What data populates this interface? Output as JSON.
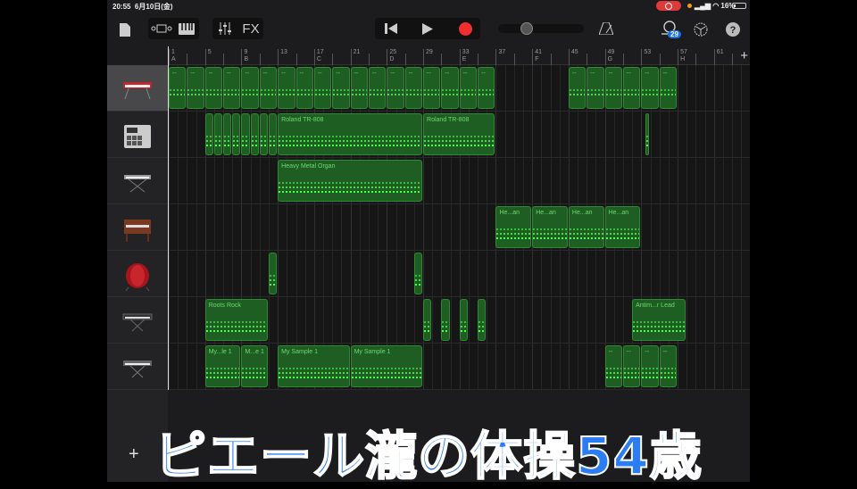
{
  "status_bar": {
    "time": "20:55",
    "date": "6月10日(金)",
    "battery": "16%"
  },
  "toolbar": {
    "fx_label": "FX",
    "loop_badge": "29",
    "icons": [
      "document-icon",
      "tracks-view-icon",
      "keyboard-icon",
      "mixer-icon",
      "rewind-icon",
      "play-icon",
      "record-icon",
      "metronome-icon",
      "loop-icon",
      "settings-icon",
      "help-icon"
    ]
  },
  "ruler": {
    "bars": [
      {
        "n": "1",
        "s": "A"
      },
      {
        "n": "5",
        "s": ""
      },
      {
        "n": "9",
        "s": "B"
      },
      {
        "n": "13",
        "s": ""
      },
      {
        "n": "17",
        "s": "C"
      },
      {
        "n": "21",
        "s": ""
      },
      {
        "n": "25",
        "s": "D"
      },
      {
        "n": "29",
        "s": ""
      },
      {
        "n": "33",
        "s": "E"
      },
      {
        "n": "37",
        "s": ""
      },
      {
        "n": "41",
        "s": "F"
      },
      {
        "n": "45",
        "s": ""
      },
      {
        "n": "49",
        "s": "G"
      },
      {
        "n": "53",
        "s": ""
      },
      {
        "n": "57",
        "s": "H"
      },
      {
        "n": "61",
        "s": ""
      }
    ],
    "add": "+"
  },
  "tracks": [
    {
      "instrument": "keyboard-red",
      "selected": true,
      "regions": [
        {
          "s": 1,
          "l": 2,
          "t": "--"
        },
        {
          "s": 3,
          "l": 2,
          "t": "--"
        },
        {
          "s": 5,
          "l": 2,
          "t": "--"
        },
        {
          "s": 7,
          "l": 2,
          "t": "--"
        },
        {
          "s": 9,
          "l": 2,
          "t": "--"
        },
        {
          "s": 11,
          "l": 2,
          "t": "--"
        },
        {
          "s": 13,
          "l": 2,
          "t": "--"
        },
        {
          "s": 15,
          "l": 2,
          "t": "--"
        },
        {
          "s": 17,
          "l": 2,
          "t": "--"
        },
        {
          "s": 19,
          "l": 2,
          "t": "--"
        },
        {
          "s": 21,
          "l": 2,
          "t": "--"
        },
        {
          "s": 23,
          "l": 2,
          "t": "--"
        },
        {
          "s": 25,
          "l": 2,
          "t": "--"
        },
        {
          "s": 27,
          "l": 2,
          "t": "--"
        },
        {
          "s": 29,
          "l": 2,
          "t": "--"
        },
        {
          "s": 31,
          "l": 2,
          "t": "--"
        },
        {
          "s": 33,
          "l": 2,
          "t": "--"
        },
        {
          "s": 35,
          "l": 2,
          "t": "--"
        },
        {
          "s": 45,
          "l": 2,
          "t": "--"
        },
        {
          "s": 47,
          "l": 2,
          "t": "--"
        },
        {
          "s": 49,
          "l": 2,
          "t": "--"
        },
        {
          "s": 51,
          "l": 2,
          "t": "--"
        },
        {
          "s": 53,
          "l": 2,
          "t": "--"
        },
        {
          "s": 55,
          "l": 2,
          "t": "--"
        }
      ]
    },
    {
      "instrument": "drum-machine",
      "selected": false,
      "regions": [
        {
          "s": 5,
          "l": 1,
          "t": ""
        },
        {
          "s": 6,
          "l": 1,
          "t": ""
        },
        {
          "s": 7,
          "l": 1,
          "t": ""
        },
        {
          "s": 8,
          "l": 1,
          "t": ""
        },
        {
          "s": 9,
          "l": 1,
          "t": ""
        },
        {
          "s": 10,
          "l": 1,
          "t": ""
        },
        {
          "s": 11,
          "l": 1,
          "t": ""
        },
        {
          "s": 12,
          "l": 1,
          "t": ""
        },
        {
          "s": 13,
          "l": 16,
          "t": "Roland TR-808"
        },
        {
          "s": 29,
          "l": 8,
          "t": "Roland TR-808"
        },
        {
          "s": 53.5,
          "l": 0.4,
          "t": ""
        }
      ]
    },
    {
      "instrument": "keyboard-stand",
      "selected": false,
      "regions": [
        {
          "s": 13,
          "l": 16,
          "t": "Heavy Metal Organ"
        }
      ]
    },
    {
      "instrument": "organ",
      "selected": false,
      "regions": [
        {
          "s": 37,
          "l": 4,
          "t": "He...an"
        },
        {
          "s": 41,
          "l": 4,
          "t": "He...an"
        },
        {
          "s": 45,
          "l": 4,
          "t": "He...an"
        },
        {
          "s": 49,
          "l": 4,
          "t": "He...an"
        }
      ]
    },
    {
      "instrument": "taiko-drum",
      "selected": false,
      "regions": [
        {
          "s": 12,
          "l": 1,
          "t": ""
        },
        {
          "s": 28,
          "l": 1,
          "t": ""
        }
      ]
    },
    {
      "instrument": "synth-keyboard",
      "selected": false,
      "regions": [
        {
          "s": 5,
          "l": 7,
          "t": "Roots Rock"
        },
        {
          "s": 29,
          "l": 1,
          "t": ""
        },
        {
          "s": 31,
          "l": 1,
          "t": ""
        },
        {
          "s": 33,
          "l": 1,
          "t": ""
        },
        {
          "s": 35,
          "l": 1,
          "t": ""
        },
        {
          "s": 52,
          "l": 6,
          "t": "Antim...r Lead"
        }
      ]
    },
    {
      "instrument": "sampler-keyboard",
      "selected": false,
      "regions": [
        {
          "s": 5,
          "l": 4,
          "t": "My...le 1"
        },
        {
          "s": 9,
          "l": 3,
          "t": "M...e 1"
        },
        {
          "s": 13,
          "l": 8,
          "t": "My Sample 1"
        },
        {
          "s": 21,
          "l": 8,
          "t": "My Sample 1"
        },
        {
          "s": 49,
          "l": 2,
          "t": "--"
        },
        {
          "s": 51,
          "l": 2,
          "t": "--"
        },
        {
          "s": 53,
          "l": 2,
          "t": "--"
        },
        {
          "s": 55,
          "l": 2,
          "t": "--"
        }
      ]
    }
  ],
  "add_track": "+",
  "caption": "ピエール瀧の体操54歳"
}
